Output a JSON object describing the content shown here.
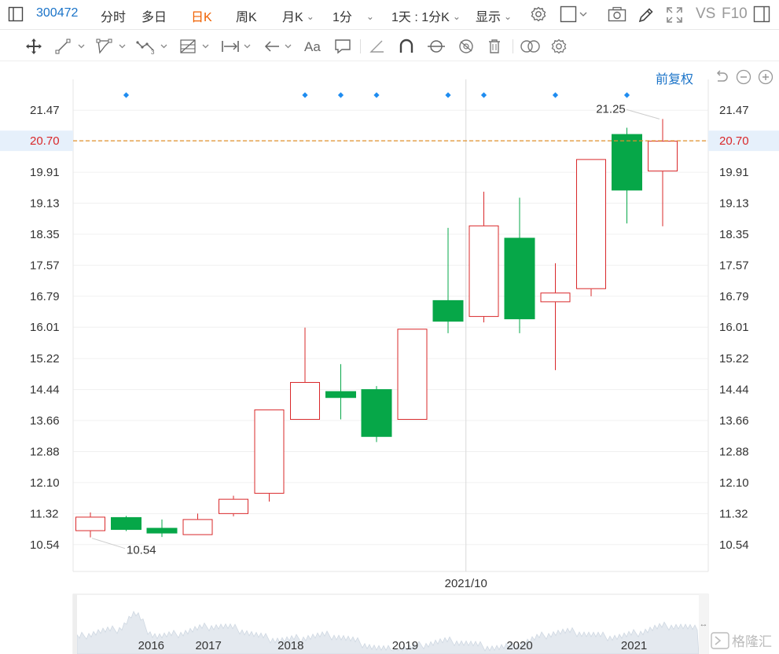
{
  "toolbar": {
    "stock_code": "300472",
    "tabs": [
      {
        "label": "分时",
        "active": false
      },
      {
        "label": "多日",
        "active": false
      },
      {
        "label": "日K",
        "active": true
      },
      {
        "label": "周K",
        "active": false
      }
    ],
    "dropdowns": [
      {
        "label": "月K"
      },
      {
        "label": "1分"
      },
      {
        "label": "1天 : 1分K"
      },
      {
        "label": "显示"
      }
    ],
    "vs_label": "VS",
    "f10_label": "F10",
    "active_color": "#f06000"
  },
  "chart_header": {
    "restore_label": "前复权"
  },
  "chart_data": {
    "type": "candlestick",
    "y_ticks": [
      "21.47",
      "20.70",
      "19.91",
      "19.13",
      "18.35",
      "17.57",
      "16.79",
      "16.01",
      "15.22",
      "14.44",
      "13.66",
      "12.88",
      "12.10",
      "11.32",
      "10.54"
    ],
    "ylim": [
      10.14,
      21.87
    ],
    "current_price": "20.70",
    "x_ticks": [
      {
        "label": "2016",
        "index": 1.7
      },
      {
        "label": "2017",
        "index": 3.3
      },
      {
        "label": "2018",
        "index": 5.6
      },
      {
        "label": "2019",
        "index": 8.8
      },
      {
        "label": "2020",
        "index": 12.0
      },
      {
        "label": "2021",
        "index": 15.2
      }
    ],
    "crosshair": {
      "label": "2021/10",
      "index": 10.5
    },
    "max_label": "21.25",
    "min_label": "10.54",
    "event_marker_indices": [
      1,
      6,
      7,
      8,
      10,
      11,
      13,
      15
    ],
    "candles": [
      {
        "open": 10.88,
        "high": 11.35,
        "low": 10.72,
        "close": 11.24
      },
      {
        "open": 11.22,
        "high": 11.26,
        "low": 10.88,
        "close": 10.92
      },
      {
        "open": 10.95,
        "high": 11.17,
        "low": 10.73,
        "close": 10.83
      },
      {
        "open": 10.78,
        "high": 11.32,
        "low": 10.78,
        "close": 11.18
      },
      {
        "open": 11.31,
        "high": 11.77,
        "low": 11.25,
        "close": 11.69
      },
      {
        "open": 11.82,
        "high": 13.94,
        "low": 11.62,
        "close": 13.94
      },
      {
        "open": 13.68,
        "high": 16.0,
        "low": 13.68,
        "close": 14.63
      },
      {
        "open": 14.39,
        "high": 15.08,
        "low": 13.69,
        "close": 14.24
      },
      {
        "open": 14.44,
        "high": 14.53,
        "low": 13.12,
        "close": 13.26
      },
      {
        "open": 13.68,
        "high": 15.97,
        "low": 13.68,
        "close": 15.97
      },
      {
        "open": 16.68,
        "high": 18.51,
        "low": 15.86,
        "close": 16.16
      },
      {
        "open": 16.27,
        "high": 19.42,
        "low": 16.13,
        "close": 18.57
      },
      {
        "open": 18.25,
        "high": 19.27,
        "low": 15.86,
        "close": 16.22
      },
      {
        "open": 16.64,
        "high": 17.62,
        "low": 14.93,
        "close": 16.88
      },
      {
        "open": 16.97,
        "high": 20.24,
        "low": 16.79,
        "close": 20.24
      },
      {
        "open": 20.86,
        "high": 21.03,
        "low": 18.62,
        "close": 19.46
      },
      {
        "open": 19.93,
        "high": 21.25,
        "low": 18.55,
        "close": 20.7
      }
    ],
    "up_color": "#d9282a",
    "down_color": "#06a748",
    "marker_color": "#1e8cf0",
    "price_line_color": "#e0902a"
  },
  "watermark": "格隆汇"
}
